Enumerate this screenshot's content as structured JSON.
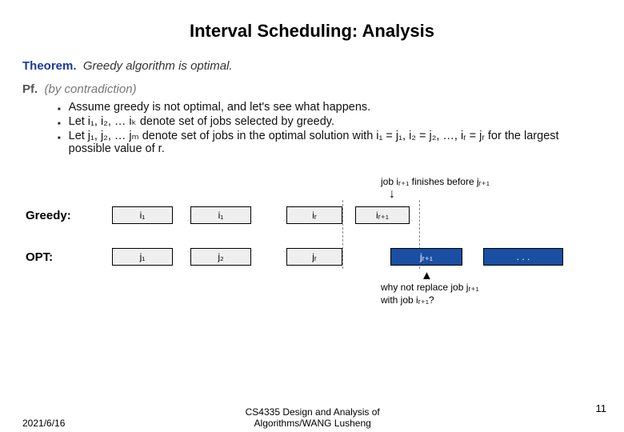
{
  "title": "Interval Scheduling:  Analysis",
  "theorem": {
    "label": "Theorem.",
    "text": "Greedy algorithm is optimal."
  },
  "proof": {
    "label": "Pf.",
    "hint": "(by contradiction)",
    "bullets": [
      "Assume greedy is not optimal, and let's see what happens.",
      "Let i₁, i₂, … iₖ denote set of jobs selected by greedy.",
      "Let j₁, j₂, … jₘ denote set of jobs in the optimal solution with i₁ = j₁, i₂ = j₂, …, iᵣ = jᵣ for the largest possible value of r."
    ]
  },
  "diagram": {
    "annotation_top": "job iᵣ₊₁ finishes before jᵣ₊₁",
    "annotation_bottom": [
      "why not replace job jᵣ₊₁",
      "with job iᵣ₊₁?"
    ],
    "greedy": {
      "label": "Greedy:",
      "bars": [
        "i₁",
        "i₁",
        "iᵣ",
        "iᵣ₊₁"
      ]
    },
    "opt": {
      "label": "OPT:",
      "bars": [
        "j₁",
        "j₂",
        "jᵣ",
        "jᵣ₊₁",
        ". . ."
      ]
    }
  },
  "page_number": "11",
  "footer": {
    "date": "2021/6/16",
    "course": [
      "CS4335  Design and Analysis of",
      "Algorithms/WANG Lusheng"
    ]
  }
}
